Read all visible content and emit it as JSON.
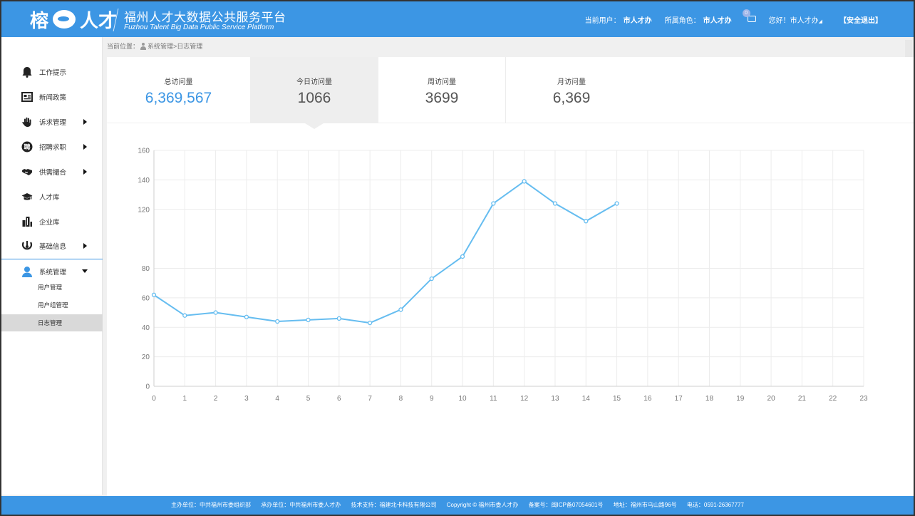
{
  "header": {
    "logo_left": "榕",
    "logo_right": "人才",
    "title_cn": "福州人才大数据公共服务平台",
    "title_en": "Fuzhou Talent Big Data Public Service Platform",
    "current_user_label": "当前用户：",
    "current_user": "市人才办",
    "role_label": "所属角色：",
    "role": "市人才办",
    "message_count": "0",
    "greeting": "您好！市人才办",
    "greeting_arrow": "◢",
    "logout": "【安全退出】",
    "color": "#3c96e4"
  },
  "sidebar": {
    "items": [
      {
        "label": "工作提示",
        "icon": "bell-icon"
      },
      {
        "label": "新闻政策",
        "icon": "news-icon"
      },
      {
        "label": "诉求管理",
        "icon": "hand-icon"
      },
      {
        "label": "招聘求职",
        "icon": "recruit-icon"
      },
      {
        "label": "供需撮合",
        "icon": "handshake-icon"
      },
      {
        "label": "人才库",
        "icon": "graduation-cap-icon"
      },
      {
        "label": "企业库",
        "icon": "building-icon"
      },
      {
        "label": "基础信息",
        "icon": "info-icon"
      },
      {
        "label": "系统管理",
        "icon": "user-icon"
      }
    ],
    "sub_items": [
      {
        "label": "用户管理"
      },
      {
        "label": "用户组管理"
      },
      {
        "label": "日志管理"
      }
    ]
  },
  "breadcrumb": {
    "prefix": "当前位置：",
    "path": "系统管理>日志管理"
  },
  "stats": [
    {
      "label": "总访问量",
      "value": "6,369,567"
    },
    {
      "label": "今日访问量",
      "value": "1066"
    },
    {
      "label": "周访问量",
      "value": "3699"
    },
    {
      "label": "月访问量",
      "value": "6,369"
    }
  ],
  "chart_data": {
    "type": "line",
    "x": [
      0,
      1,
      2,
      3,
      4,
      5,
      6,
      7,
      8,
      9,
      10,
      11,
      12,
      13,
      14,
      15
    ],
    "x_ticks": [
      0,
      1,
      2,
      3,
      4,
      5,
      6,
      7,
      8,
      9,
      10,
      11,
      12,
      13,
      14,
      15,
      16,
      17,
      18,
      19,
      20,
      21,
      22,
      23
    ],
    "y": [
      62,
      48,
      50,
      47,
      44,
      45,
      46,
      43,
      52,
      73,
      88,
      124,
      139,
      124,
      112,
      124
    ],
    "y_ticks": [
      0,
      20,
      40,
      60,
      80,
      120,
      140,
      160
    ],
    "xlim": [
      0,
      23
    ],
    "ylim": [
      0,
      160
    ],
    "grid": true,
    "color": "#66bdf0"
  },
  "footer": {
    "host": "主办单位：中共福州市委组织部",
    "organizer": "承办单位：中共福州市委人才办",
    "support": "技术支持：福建北卡科技有限公司",
    "copyright": "Copyright © 福州市委人才办",
    "icp": "备案号：闽ICP备07054601号",
    "address": "地址：福州市乌山路96号",
    "phone": "电话：0591-26367777"
  }
}
